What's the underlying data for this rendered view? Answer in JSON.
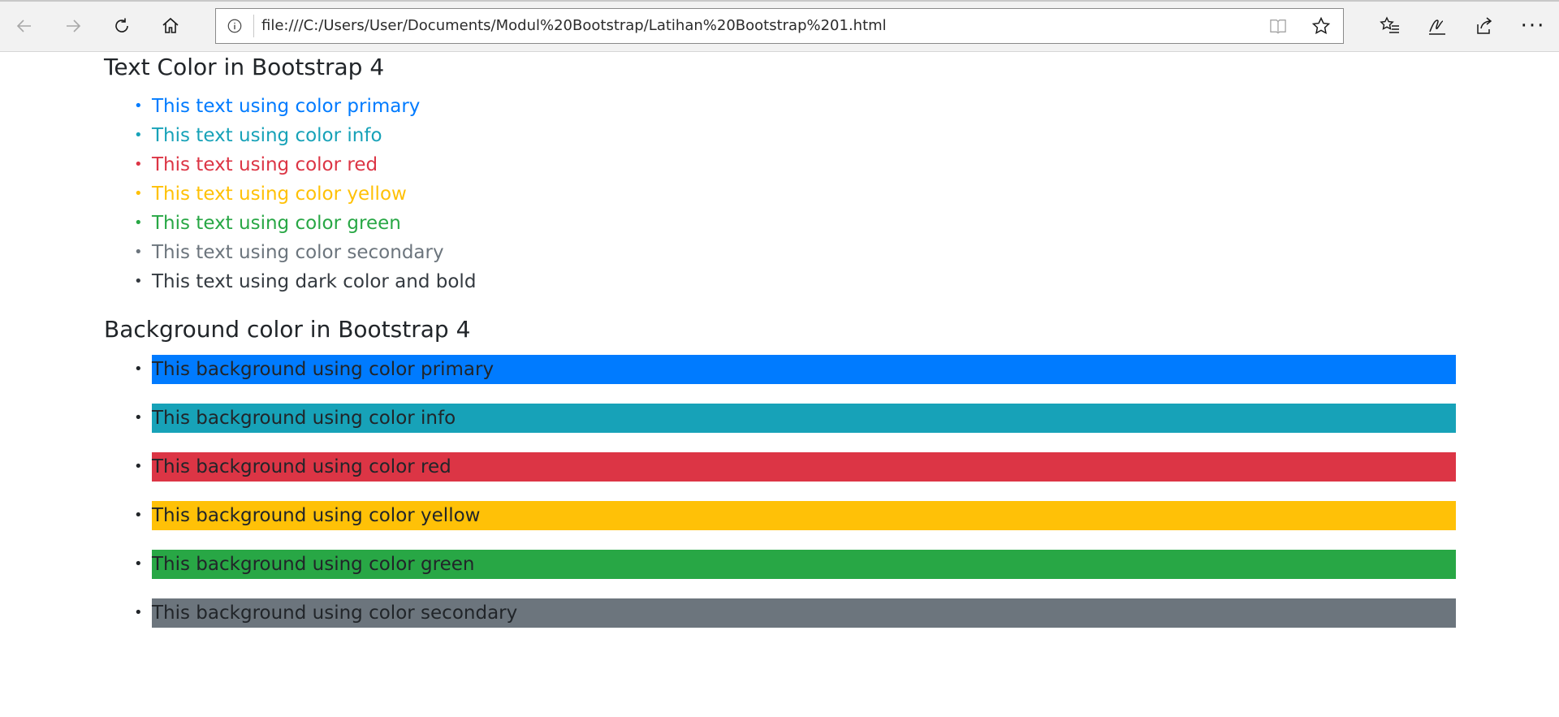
{
  "browser": {
    "url": "file:///C:/Users/User/Documents/Modul%20Bootstrap/Latihan%20Bootstrap%201.html",
    "more_label": "···"
  },
  "page": {
    "text_heading": "Text Color in Bootstrap 4",
    "text_items": [
      {
        "label": "This text using color primary",
        "color": "#007bff"
      },
      {
        "label": "This text using color info",
        "color": "#17a2b8"
      },
      {
        "label": "This text using color red",
        "color": "#dc3545"
      },
      {
        "label": "This text using color yellow",
        "color": "#ffc107"
      },
      {
        "label": "This text using color green",
        "color": "#28a745"
      },
      {
        "label": "This text using color secondary",
        "color": "#6c757d"
      },
      {
        "label": "This text using dark color and bold",
        "color": "#343a40"
      }
    ],
    "bg_heading": "Background color in Bootstrap 4",
    "bg_items": [
      {
        "label": "This background using color primary",
        "color": "#007bff"
      },
      {
        "label": "This background using color info",
        "color": "#17a2b8"
      },
      {
        "label": "This background using color red",
        "color": "#dc3545"
      },
      {
        "label": "This background using color yellow",
        "color": "#ffc107"
      },
      {
        "label": "This background using color green",
        "color": "#28a745"
      },
      {
        "label": "This background using color secondary",
        "color": "#6c757d"
      }
    ],
    "bullet": "•"
  }
}
